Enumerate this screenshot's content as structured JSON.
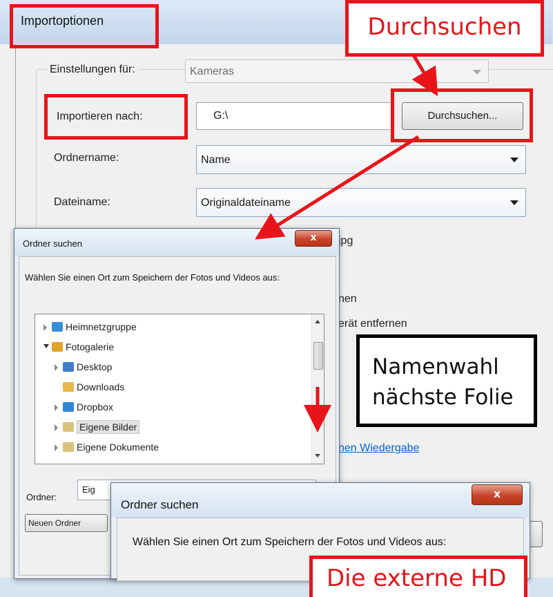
{
  "import_dialog": {
    "title": "Importoptionen",
    "settings_for_label": "Einstellungen für:",
    "settings_for_value": "Kameras",
    "import_to_label": "Importieren nach:",
    "import_to_value": "G:\\",
    "browse_button": "Durchsuchen...",
    "folder_name_label": "Ordnername:",
    "folder_name_value": "Name",
    "file_name_label": "Dateiname:",
    "file_name_value": "Originaldateiname",
    "partial_text_1": "jpg",
    "partial_text_2": "nen",
    "partial_text_3": "erät entfernen",
    "partial_link": "nen Wiedergabe"
  },
  "folder_dialog_1": {
    "title": "Ordner suchen",
    "close_label": "x",
    "prompt": "Wählen Sie einen Ort zum Speichern der Fotos und Videos aus:",
    "tree": [
      {
        "label": "Heimnetzgruppe",
        "indent": 0,
        "expander": "closed",
        "icon": "homegroup"
      },
      {
        "label": "Fotogalerie",
        "indent": 0,
        "expander": "open",
        "icon": "gallery"
      },
      {
        "label": "Desktop",
        "indent": 1,
        "expander": "closed",
        "icon": "desktop"
      },
      {
        "label": "Downloads",
        "indent": 1,
        "expander": "none",
        "icon": "downloads"
      },
      {
        "label": "Dropbox",
        "indent": 1,
        "expander": "closed",
        "icon": "dropbox"
      },
      {
        "label": "Eigene Bilder",
        "indent": 1,
        "expander": "closed",
        "icon": "pictures",
        "selected": true
      },
      {
        "label": "Eigene Dokumente",
        "indent": 1,
        "expander": "closed",
        "icon": "documents"
      }
    ],
    "folder_label": "Ordner:",
    "folder_value": "Eig",
    "new_folder_button": "Neuen Ordner"
  },
  "folder_dialog_2": {
    "title": "Ordner suchen",
    "close_label": "x",
    "prompt": "Wählen Sie einen Ort zum Speichern der Fotos und Videos aus:"
  },
  "annotations": {
    "durchsuchen_callout": "Durchsuchen",
    "namenwahl_line1": "Namenwahl",
    "namenwahl_line2": "nächste Folie",
    "bottom_callout": "Die externe HD"
  },
  "colors": {
    "annotation_red": "#e8141a",
    "window_bg": "#f0f0f0",
    "link_blue": "#0066cc"
  }
}
